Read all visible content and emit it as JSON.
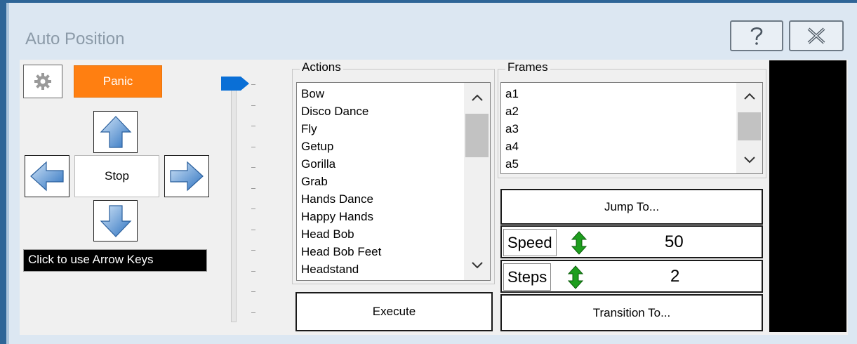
{
  "window": {
    "title": "Auto Position"
  },
  "controls": {
    "panic_label": "Panic",
    "stop_label": "Stop",
    "arrow_keys_label": "Click to use Arrow Keys"
  },
  "actions": {
    "group_label": "Actions",
    "items": [
      "Bow",
      "Disco Dance",
      "Fly",
      "Getup",
      "Gorilla",
      "Grab",
      "Hands Dance",
      "Happy Hands",
      "Head Bob",
      "Head Bob Feet",
      "Headstand"
    ]
  },
  "frames": {
    "group_label": "Frames",
    "items": [
      "a1",
      "a2",
      "a3",
      "a4",
      "a5"
    ]
  },
  "buttons": {
    "execute_label": "Execute",
    "jump_label": "Jump To...",
    "transition_label": "Transition To..."
  },
  "speed": {
    "label": "Speed",
    "value": "50"
  },
  "steps": {
    "label": "Steps",
    "value": "2"
  },
  "slider": {
    "level": 1.0
  },
  "colors": {
    "panic": "#ff7f11",
    "accent": "#2e6597",
    "slider_thumb": "#0a6fd6",
    "spin": "#1e9e1e"
  }
}
